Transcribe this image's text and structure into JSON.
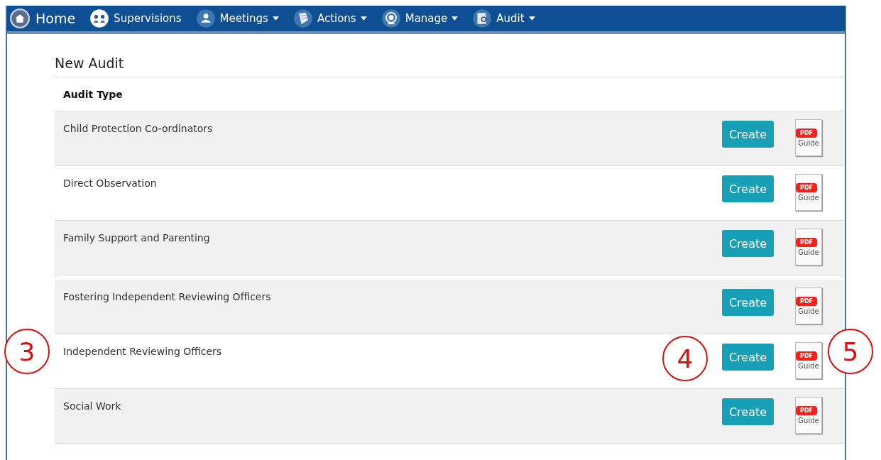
{
  "nav": [
    {
      "label": "Home",
      "caret": false
    },
    {
      "label": "Supervisions",
      "caret": false
    },
    {
      "label": "Meetings",
      "caret": true
    },
    {
      "label": "Actions",
      "caret": true
    },
    {
      "label": "Manage",
      "caret": true
    },
    {
      "label": "Audit",
      "caret": true
    }
  ],
  "page_title": "New Audit",
  "table": {
    "columns": [
      "Audit Type"
    ],
    "rows": [
      {
        "name": "Child Protection Co-ordinators",
        "shaded": true,
        "button": "Create",
        "guide": {
          "badge": "PDF",
          "caption": "Guide"
        }
      },
      {
        "name": "Direct Observation",
        "shaded": false,
        "button": "Create",
        "guide": {
          "badge": "PDF",
          "caption": "Guide"
        }
      },
      {
        "name": "Family Support and Parenting",
        "shaded": true,
        "button": "Create",
        "guide": {
          "badge": "PDF",
          "caption": "Guide"
        }
      },
      {
        "name": "Fostering Independent Reviewing Officers",
        "shaded": true,
        "button": "Create",
        "guide": {
          "badge": "PDF",
          "caption": "Guide"
        }
      },
      {
        "name": "Independent Reviewing Officers",
        "shaded": false,
        "button": "Create",
        "guide": {
          "badge": "PDF",
          "caption": "Guide"
        },
        "callouts": [
          {
            "kind": "row",
            "text": "3"
          },
          {
            "kind": "create",
            "text": "4"
          },
          {
            "kind": "guide",
            "text": "5"
          }
        ]
      },
      {
        "name": "Social Work",
        "shaded": true,
        "button": "Create",
        "guide": {
          "badge": "PDF",
          "caption": "Guide"
        }
      }
    ]
  }
}
